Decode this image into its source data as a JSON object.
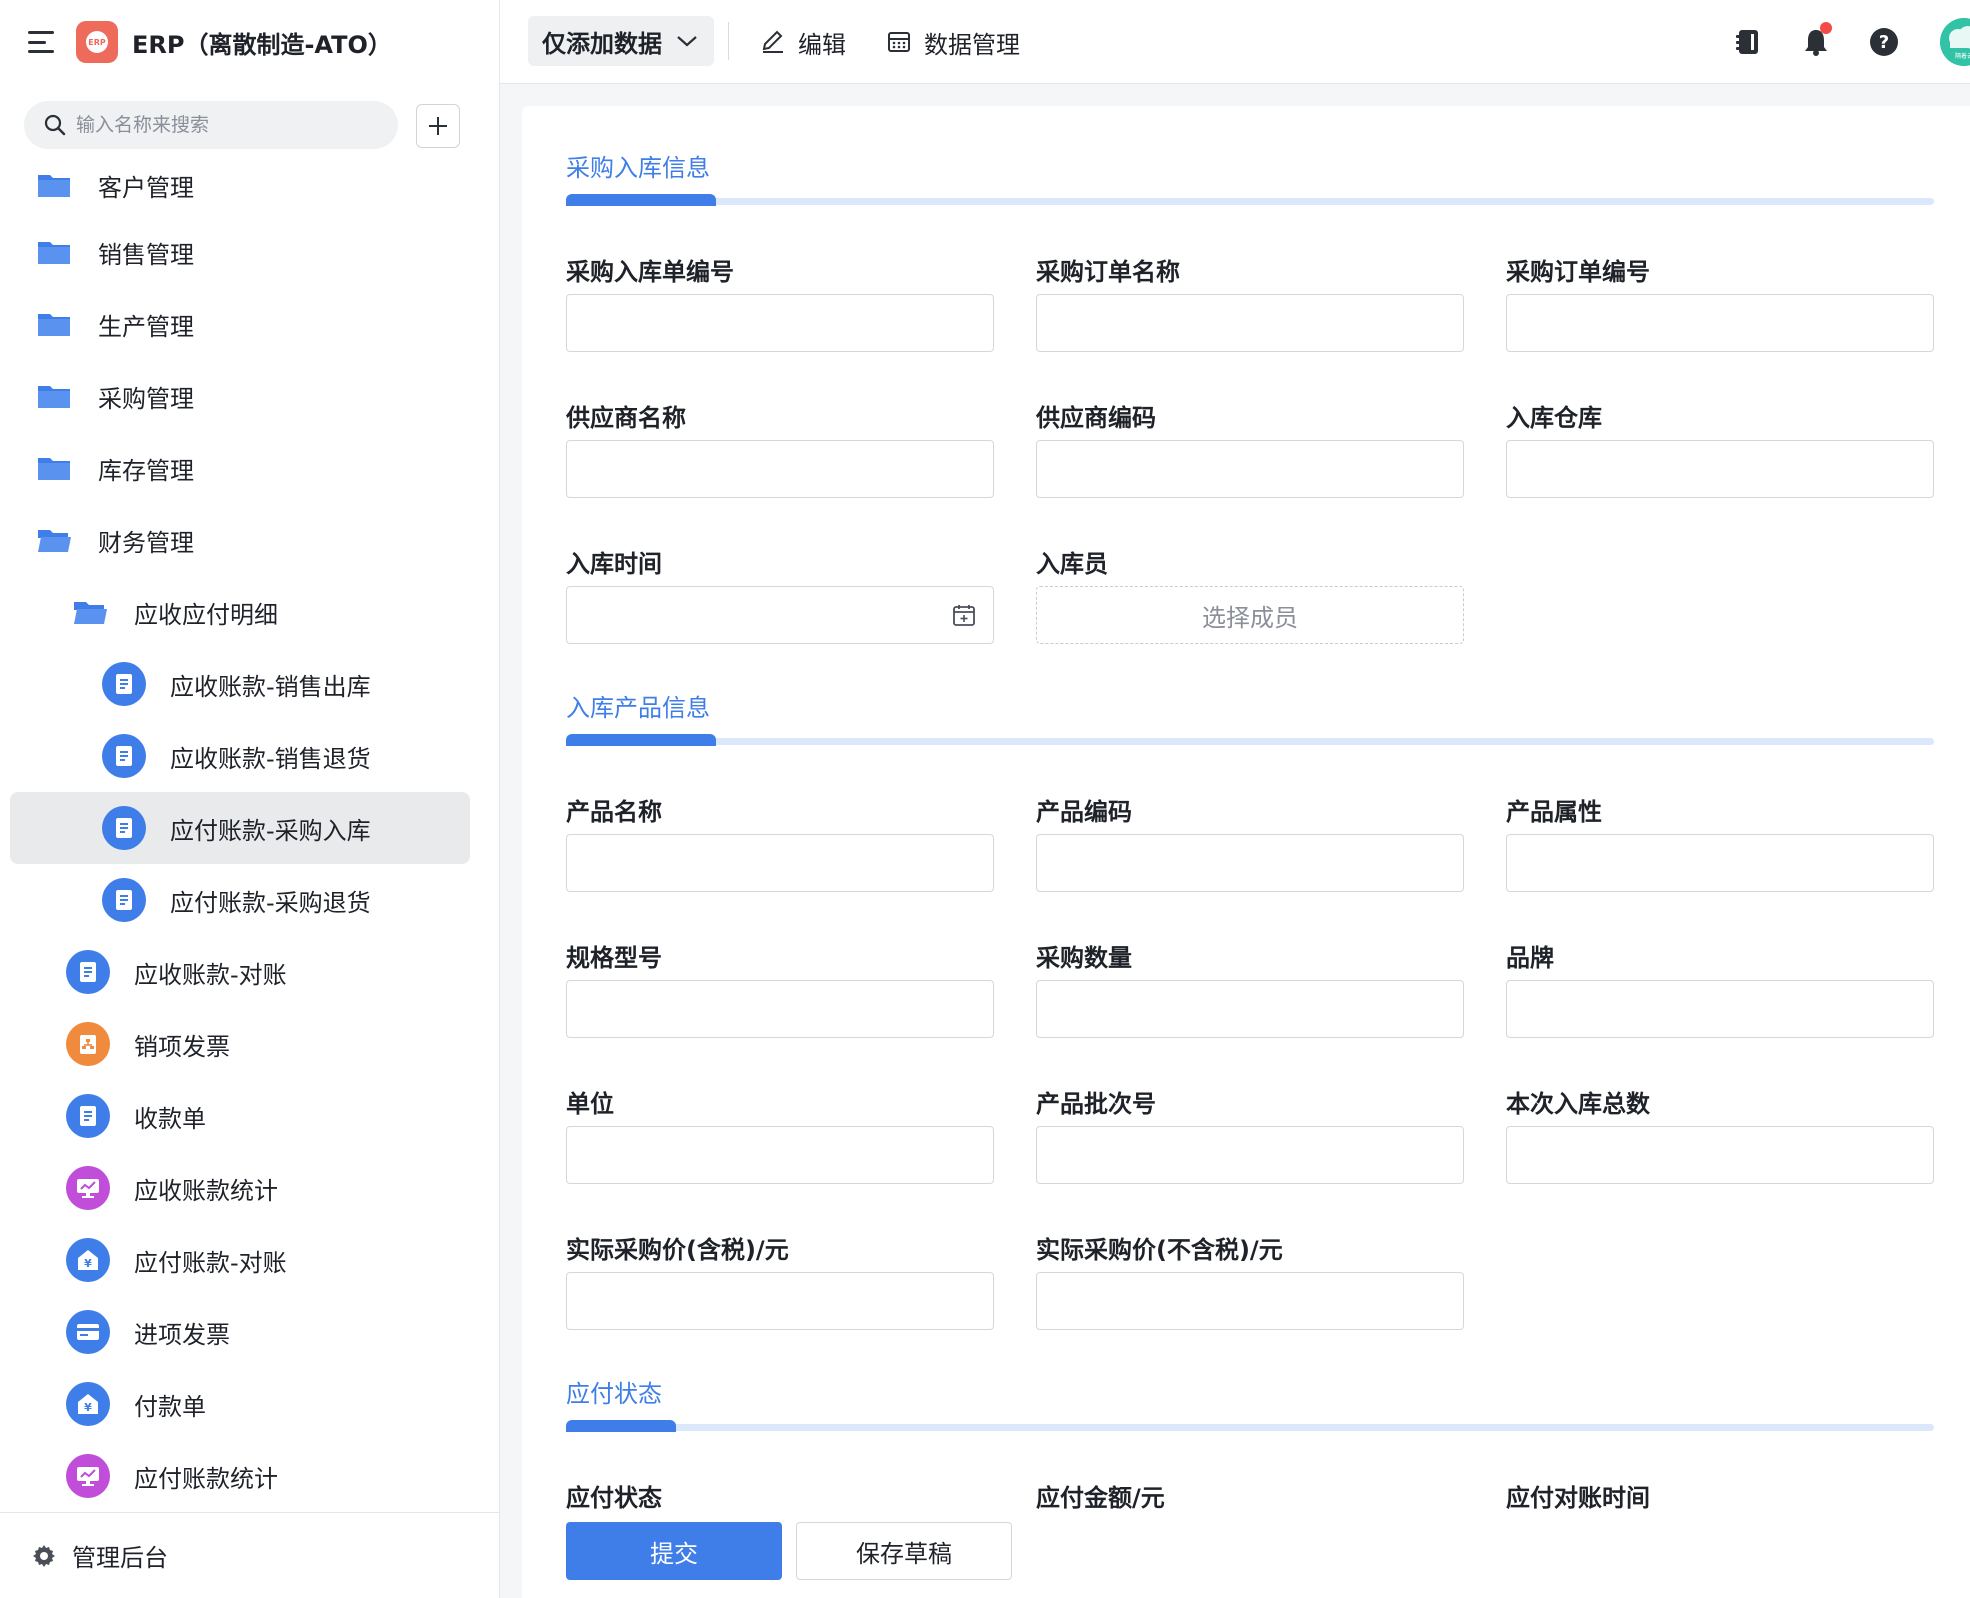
{
  "app": {
    "logo_text": "ERP",
    "title": "ERP（离散制造-ATO）"
  },
  "sidebar": {
    "search_placeholder": "输入名称来搜索",
    "items": [
      {
        "label": "客户管理",
        "icon": "folder-icon"
      },
      {
        "label": "销售管理",
        "icon": "folder-icon"
      },
      {
        "label": "生产管理",
        "icon": "folder-icon"
      },
      {
        "label": "采购管理",
        "icon": "folder-icon"
      },
      {
        "label": "库存管理",
        "icon": "folder-icon"
      },
      {
        "label": "财务管理",
        "icon": "folder-open-icon"
      },
      {
        "label": "应收应付明细",
        "icon": "folder-open-icon"
      },
      {
        "label": "应收账款-销售出库",
        "icon": "document-icon"
      },
      {
        "label": "应收账款-销售退货",
        "icon": "document-icon"
      },
      {
        "label": "应付账款-采购入库",
        "icon": "document-icon",
        "active": true
      },
      {
        "label": "应付账款-采购退货",
        "icon": "document-icon"
      },
      {
        "label": "应收账款-对账",
        "icon": "document-icon"
      },
      {
        "label": "销项发票",
        "icon": "org-chart-icon"
      },
      {
        "label": "收款单",
        "icon": "document-icon"
      },
      {
        "label": "应收账款统计",
        "icon": "monitor-chart-icon"
      },
      {
        "label": "应付账款-对账",
        "icon": "yuan-house-icon"
      },
      {
        "label": "进项发票",
        "icon": "card-icon"
      },
      {
        "label": "付款单",
        "icon": "yuan-house-icon"
      },
      {
        "label": "应付账款统计",
        "icon": "monitor-chart-icon"
      }
    ],
    "footer_label": "管理后台"
  },
  "topbar": {
    "view_label": "仅添加数据",
    "edit_label": "编辑",
    "data_manage_label": "数据管理",
    "avatar_text": "隔着云"
  },
  "form": {
    "sections": {
      "inbound_info": "采购入库信息",
      "product_info": "入库产品信息",
      "payable_status": "应付状态"
    },
    "fields": {
      "inbound_no": "采购入库单编号",
      "po_name": "采购订单名称",
      "po_no": "采购订单编号",
      "supplier_name": "供应商名称",
      "supplier_code": "供应商编码",
      "warehouse": "入库仓库",
      "inbound_time": "入库时间",
      "inbound_staff": "入库员",
      "product_name": "产品名称",
      "product_code": "产品编码",
      "product_attr": "产品属性",
      "spec_model": "规格型号",
      "purchase_qty": "采购数量",
      "brand": "品牌",
      "unit": "单位",
      "batch_no": "产品批次号",
      "total_qty": "本次入库总数",
      "price_tax": "实际采购价(含税)/元",
      "price_no_tax": "实际采购价(不含税)/元",
      "payable_status": "应付状态",
      "payable_amount": "应付金额/元",
      "reconcile_time": "应付对账时间"
    },
    "member_placeholder": "选择成员",
    "submit_label": "提交",
    "draft_label": "保存草稿"
  },
  "colors": {
    "accent": "#3f7ee8",
    "folder": "#3f7ee8",
    "doc_icon_bg": "#3f7ee8",
    "orange_icon_bg": "#f08a3c",
    "purple_icon_bg": "#c04ed8",
    "notification_dot": "#f54a45"
  }
}
